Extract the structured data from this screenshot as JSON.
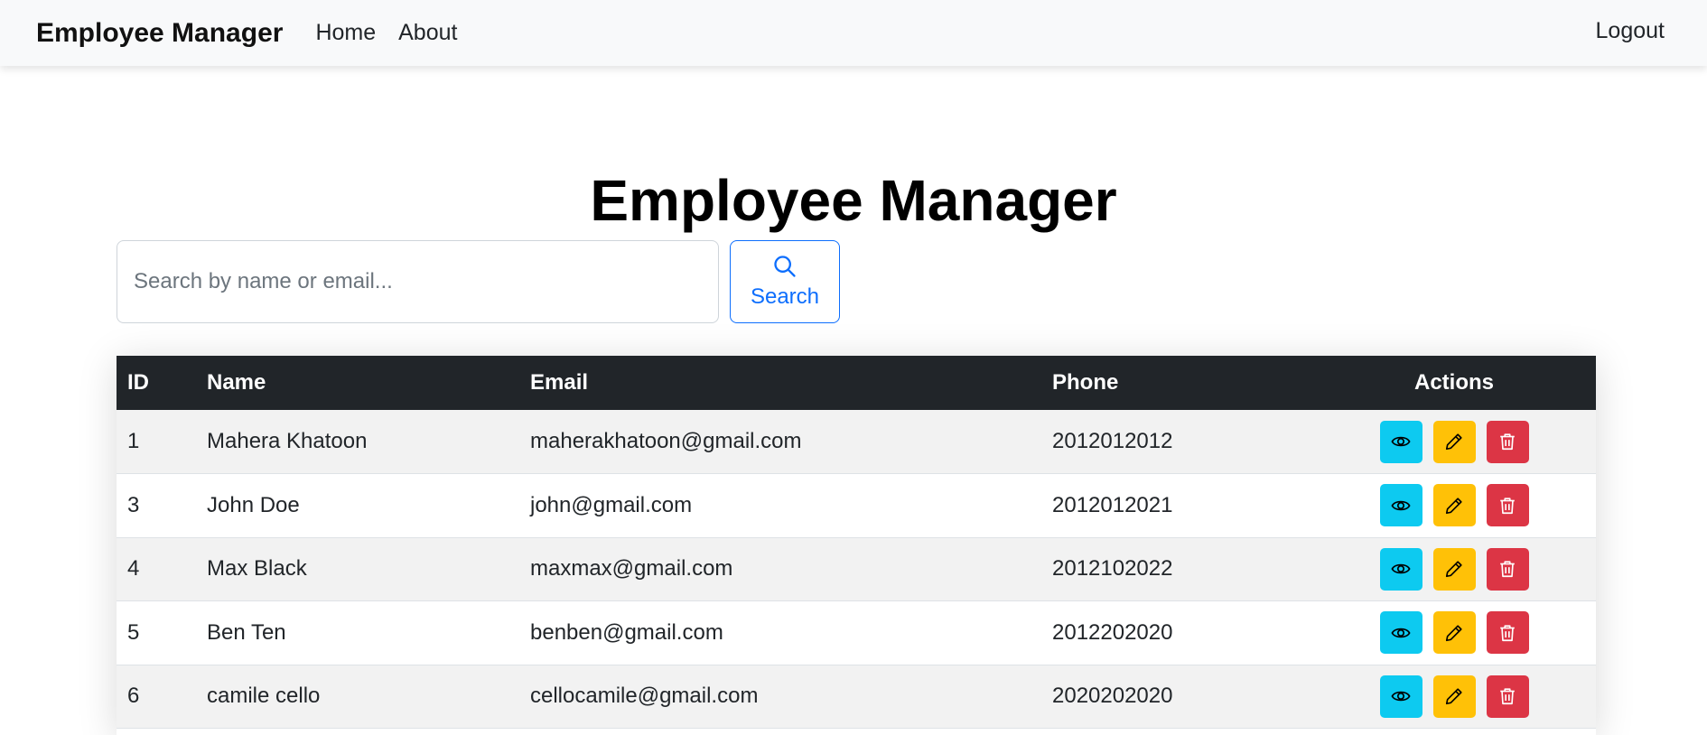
{
  "navbar": {
    "brand": "Employee Manager",
    "links": [
      "Home",
      "About"
    ],
    "logout": "Logout"
  },
  "page": {
    "title": "Employee Manager"
  },
  "search": {
    "placeholder": "Search by name or email...",
    "button_label": "Search"
  },
  "table": {
    "headers": [
      "ID",
      "Name",
      "Email",
      "Phone",
      "Actions"
    ],
    "rows": [
      [
        "1",
        "Mahera Khatoon",
        "maherakhatoon@gmail.com",
        "2012012012"
      ],
      [
        "3",
        "John Doe",
        "john@gmail.com",
        "2012012021"
      ],
      [
        "4",
        "Max Black",
        "maxmax@gmail.com",
        "2012102022"
      ],
      [
        "5",
        "Ben Ten",
        "benben@gmail.com",
        "2012202020"
      ],
      [
        "6",
        "camile cello",
        "cellocamile@gmail.com",
        "2020202020"
      ]
    ]
  },
  "actions": {
    "view_icon": "eye-icon",
    "edit_icon": "pencil-icon",
    "delete_icon": "trash-icon"
  },
  "colors": {
    "header_bg": "#212529",
    "primary": "#0d6efd",
    "info": "#0dcaf0",
    "warning": "#ffc107",
    "danger": "#dc3545"
  }
}
